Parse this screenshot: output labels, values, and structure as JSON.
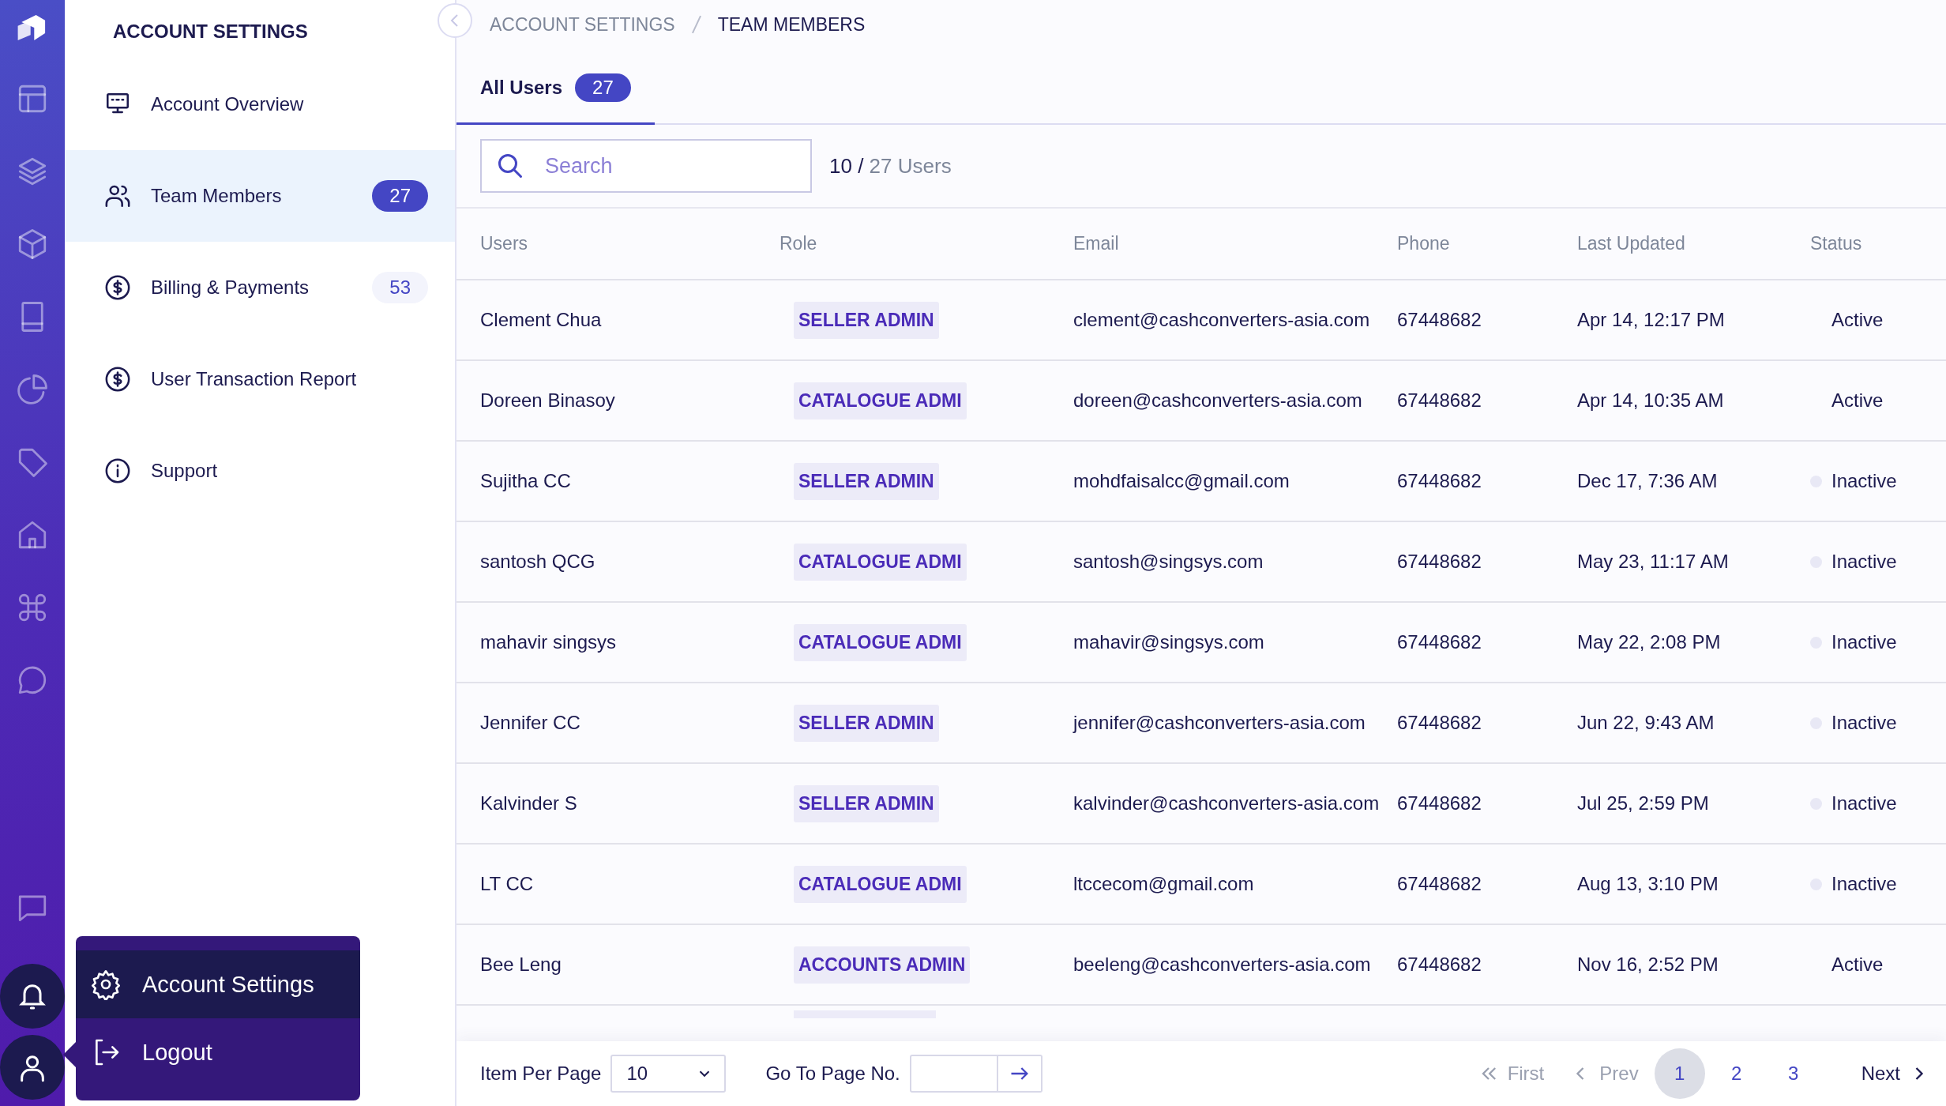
{
  "sidebar": {
    "title": "ACCOUNT SETTINGS",
    "items": [
      {
        "label": "Account Overview",
        "selected": false
      },
      {
        "label": "Team Members",
        "count": "27",
        "selected": true
      },
      {
        "label": "Billing & Payments",
        "count": "53",
        "selected": false
      },
      {
        "label": "User Transaction Report",
        "selected": false
      },
      {
        "label": "Support",
        "selected": false
      }
    ]
  },
  "user_menu": {
    "items": [
      {
        "label": "Account Settings",
        "selected": true
      },
      {
        "label": "Logout",
        "selected": false
      }
    ]
  },
  "breadcrumb": [
    "ACCOUNT SETTINGS",
    "TEAM MEMBERS"
  ],
  "tabs": [
    {
      "label": "All Users",
      "count": "27",
      "selected": true
    }
  ],
  "search": {
    "placeholder": "Search"
  },
  "result_count": {
    "shown": "10 /",
    "total": "27 Users"
  },
  "table": {
    "columns": [
      "Users",
      "Role",
      "Email",
      "Phone",
      "Last Updated",
      "Status"
    ],
    "rows": [
      {
        "user": "Clement Chua",
        "role": "SELLER ADMIN",
        "email": "clement@cashconverters-asia.com",
        "phone": "67448682",
        "last_updated": "Apr 14, 12:17 PM",
        "status": "Active",
        "active": true
      },
      {
        "user": "Doreen Binasoy",
        "role": "CATALOGUE ADMI",
        "email": "doreen@cashconverters-asia.com",
        "phone": "67448682",
        "last_updated": "Apr 14, 10:35 AM",
        "status": "Active",
        "active": true
      },
      {
        "user": "Sujitha CC",
        "role": "SELLER ADMIN",
        "email": "mohdfaisalcc@gmail.com",
        "phone": "67448682",
        "last_updated": "Dec 17, 7:36 AM",
        "status": "Inactive",
        "active": false
      },
      {
        "user": "santosh QCG",
        "role": "CATALOGUE ADMI",
        "email": "santosh@singsys.com",
        "phone": "67448682",
        "last_updated": "May 23, 11:17 AM",
        "status": "Inactive",
        "active": false
      },
      {
        "user": "mahavir singsys",
        "role": "CATALOGUE ADMI",
        "email": "mahavir@singsys.com",
        "phone": "67448682",
        "last_updated": "May 22, 2:08 PM",
        "status": "Inactive",
        "active": false
      },
      {
        "user": "Jennifer CC",
        "role": "SELLER ADMIN",
        "email": "jennifer@cashconverters-asia.com",
        "phone": "67448682",
        "last_updated": "Jun 22, 9:43 AM",
        "status": "Inactive",
        "active": false
      },
      {
        "user": "Kalvinder S",
        "role": "SELLER ADMIN",
        "email": "kalvinder@cashconverters-asia.com",
        "phone": "67448682",
        "last_updated": "Jul 25, 2:59 PM",
        "status": "Inactive",
        "active": false
      },
      {
        "user": "LT CC",
        "role": "CATALOGUE ADMI",
        "email": "ltccecom@gmail.com",
        "phone": "67448682",
        "last_updated": "Aug 13, 3:10 PM",
        "status": "Inactive",
        "active": false
      },
      {
        "user": "Bee Leng",
        "role": "ACCOUNTS ADMIN",
        "email": "beeleng@cashconverters-asia.com",
        "phone": "67448682",
        "last_updated": "Nov 16, 2:52 PM",
        "status": "Active",
        "active": true
      }
    ]
  },
  "pagination": {
    "items_per_page_label": "Item Per Page",
    "items_per_page": "10",
    "goto_label": "Go To Page No.",
    "first": {
      "label": "First",
      "disabled": true
    },
    "prev": {
      "label": "Prev",
      "disabled": true
    },
    "pages": [
      {
        "label": "1",
        "selected": true
      },
      {
        "label": "2",
        "selected": false
      },
      {
        "label": "3",
        "selected": false
      }
    ],
    "next": {
      "label": "Next",
      "disabled": false
    }
  }
}
